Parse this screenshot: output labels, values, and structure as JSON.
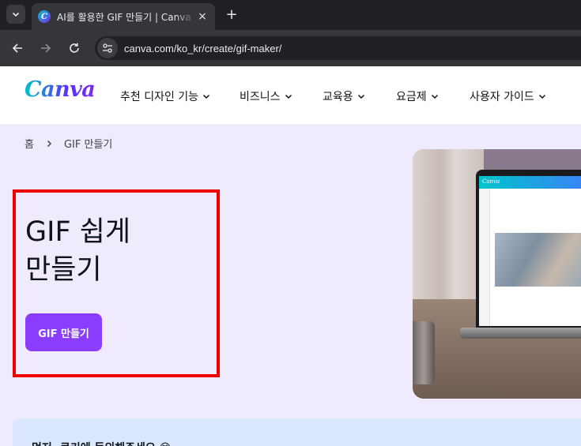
{
  "browser": {
    "tab_title": "AI를 활용한 GIF 만들기 | Canva",
    "url": "canva.com/ko_kr/create/gif-maker/",
    "favicon_letter": "C",
    "new_tab_label": "+",
    "close_label": "×"
  },
  "site": {
    "logo": "Canva",
    "nav": [
      "추천 디자인 기능",
      "비즈니스",
      "교육용",
      "요금제",
      "사용자 가이드"
    ]
  },
  "breadcrumb": {
    "home": "홈",
    "current": "GIF 만들기"
  },
  "hero": {
    "title_line1": "GIF 쉽게",
    "title_line2": "만들기",
    "cta_label": "GIF 만들기"
  },
  "laptop_screen_logo": "Canva",
  "cookie_banner": {
    "text": "먼저, 쿠키에 동의해주세요 😊"
  },
  "colors": {
    "page_bg": "#f0eafd",
    "cta": "#8b3dff",
    "highlight": "#ee0000",
    "cookie_bg": "#dbe7ff"
  }
}
